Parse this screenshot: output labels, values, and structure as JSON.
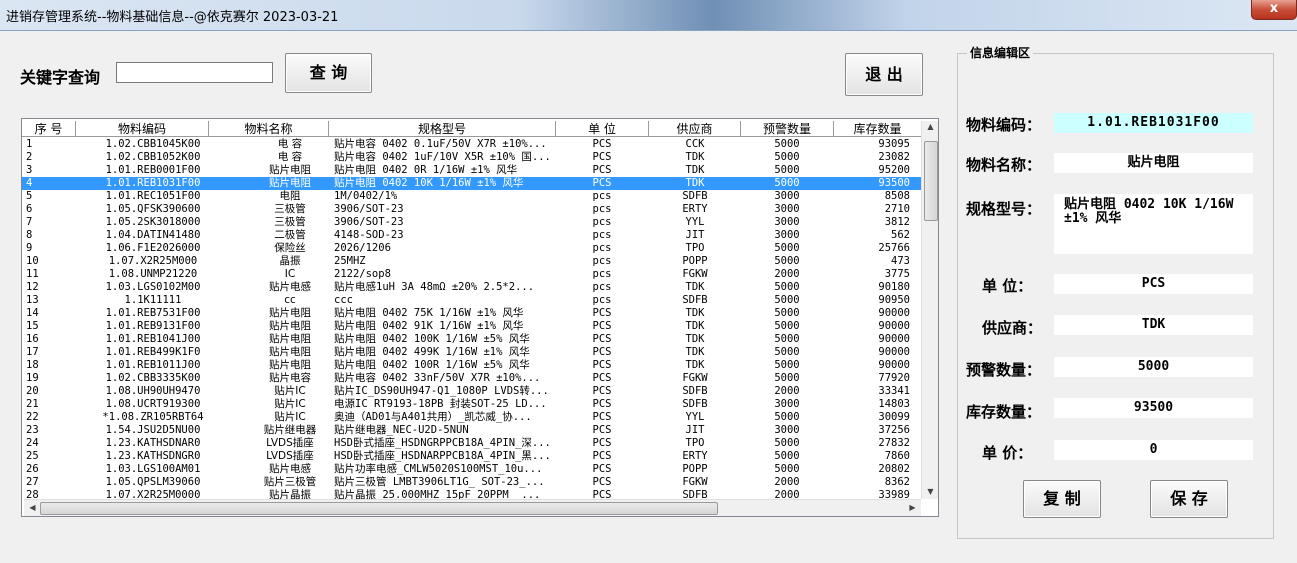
{
  "window": {
    "title": "进销存管理系统--物料基础信息--@依克赛尔 2023-03-21",
    "close_symbol": "x"
  },
  "search": {
    "label": "关键字查询",
    "value": "",
    "query_button": "查 询"
  },
  "exit_button": "退 出",
  "grid": {
    "columns": [
      "序 号",
      "物料编码",
      "物料名称",
      "规格型号",
      "单 位",
      "供应商",
      "预警数量",
      "库存数量"
    ],
    "selected_index": 3,
    "rows": [
      [
        "1",
        "1.02.CBB1045K00",
        "电  容",
        "贴片电容 0402 0.1uF/50V X7R ±10%...",
        "PCS",
        "CCK",
        "5000",
        "93095"
      ],
      [
        "2",
        "1.02.CBB1052K00",
        "电  容",
        "贴片电容 0402 1uF/10V X5R ±10% 国...",
        "PCS",
        "TDK",
        "5000",
        "23082"
      ],
      [
        "3",
        "1.01.REB0001F00",
        "贴片电阻",
        "贴片电阻 0402 0R 1/16W ±1% 风华",
        "PCS",
        "TDK",
        "5000",
        "95200"
      ],
      [
        "4",
        "1.01.REB1031F00",
        "贴片电阻",
        "贴片电阻 0402 10K 1/16W ±1% 风华",
        "PCS",
        "TDK",
        "5000",
        "93500"
      ],
      [
        "5",
        "1.01.REC1051F00",
        "电阻",
        "1M/0402/1%",
        "pcs",
        "SDFB",
        "3000",
        "8508"
      ],
      [
        "6",
        "1.05.QFSK390600",
        "三极管",
        "3906/SOT-23",
        "pcs",
        "ERTY",
        "3000",
        "2710"
      ],
      [
        "7",
        "1.05.2SK3018000",
        "三极管",
        "3906/SOT-23",
        "pcs",
        "YYL",
        "3000",
        "3812"
      ],
      [
        "8",
        "1.04.DATIN41480",
        "二极管",
        "4148-SOD-23",
        "pcs",
        "JIT",
        "3000",
        "562"
      ],
      [
        "9",
        "1.06.F1E2026000",
        "保险丝",
        "2026/1206",
        "pcs",
        "TPO",
        "5000",
        "25766"
      ],
      [
        "10",
        "1.07.X2R25M000",
        "晶振",
        "25MHZ",
        "pcs",
        "POPP",
        "5000",
        "473"
      ],
      [
        "11",
        "1.08.UNMP21220",
        "IC",
        "2122/sop8",
        "pcs",
        "FGKW",
        "2000",
        "3775"
      ],
      [
        "12",
        "1.03.LGS0102M00",
        "贴片电感",
        "贴片电感1uH 3A 48mΩ  ±20% 2.5*2...",
        "pcs",
        "TDK",
        "5000",
        "90180"
      ],
      [
        "13",
        "1.1K11111",
        "cc",
        "ccc",
        "pcs",
        "SDFB",
        "5000",
        "90950"
      ],
      [
        "14",
        "1.01.REB7531F00",
        "贴片电阻",
        "贴片电阻 0402 75K  1/16W  ±1%  风华",
        "PCS",
        "TDK",
        "5000",
        "90000"
      ],
      [
        "15",
        "1.01.REB9131F00",
        "贴片电阻",
        "贴片电阻 0402 91K 1/16W ±1%  风华",
        "PCS",
        "TDK",
        "5000",
        "90000"
      ],
      [
        "16",
        "1.01.REB1041J00",
        "贴片电阻",
        "贴片电阻 0402 100K 1/16W ±5% 风华",
        "PCS",
        "TDK",
        "5000",
        "90000"
      ],
      [
        "17",
        "1.01.REB499K1F0",
        "贴片电阻",
        "贴片电阻 0402 499K 1/16W ±1% 风华",
        "PCS",
        "TDK",
        "5000",
        "90000"
      ],
      [
        "18",
        "1.01.REB1011J00",
        "贴片电阻",
        "贴片电阻 0402 100R 1/16W ±5% 风华",
        "PCS",
        "TDK",
        "5000",
        "90000"
      ],
      [
        "19",
        "1.02.CBB3335K00",
        "贴片电容",
        "贴片电容 0402 33nF/50V X7R ±10%...",
        "PCS",
        "FGKW",
        "5000",
        "77920"
      ],
      [
        "20",
        "1.08.UH90UH9470",
        "贴片IC",
        "贴片IC_DS90UH947-Q1_1080P LVDS转...",
        "PCS",
        "SDFB",
        "2000",
        "33341"
      ],
      [
        "21",
        "1.08.UCRT919300",
        "贴片IC",
        "电源IC RT9193-18PB 封装SOT-25 LD...",
        "PCS",
        "SDFB",
        "3000",
        "14803"
      ],
      [
        "22",
        "*1.08.ZR105RBT64",
        "贴片IC",
        "奥迪（AD01与A401共用）_凯芯威_协...",
        "PCS",
        "YYL",
        "5000",
        "30099"
      ],
      [
        "23",
        "1.54.JSU2D5NU00",
        "贴片继电器",
        "贴片继电器_NEC-U2D-5NUN",
        "PCS",
        "JIT",
        "3000",
        "37256"
      ],
      [
        "24",
        "1.23.KATHSDNAR0",
        "LVDS插座",
        "HSD卧式插座_HSDNGRPPCB18A_4PIN_深...",
        "PCS",
        "TPO",
        "5000",
        "27832"
      ],
      [
        "25",
        "1.23.KATHSDNGR0",
        "LVDS插座",
        "HSD卧式插座_HSDNARPPCB18A_4PIN_黑...",
        "PCS",
        "ERTY",
        "5000",
        "7860"
      ],
      [
        "26",
        "1.03.LGS100AM01",
        "贴片电感",
        "贴片功率电感_CMLW5020S100MST_10u...",
        "PCS",
        "POPP",
        "5000",
        "20802"
      ],
      [
        "27",
        "1.05.QPSLM39060",
        "贴片三极管",
        "贴片三极管 LMBT3906LT1G_ SOT-23_...",
        "PCS",
        "FGKW",
        "2000",
        "8362"
      ],
      [
        "28",
        "1.07.X2R25M0000",
        "贴片晶振",
        "贴片晶振 25.000MHZ 15pF 20PPM _...",
        "PCS",
        "SDFB",
        "2000",
        "33989"
      ]
    ]
  },
  "edit": {
    "legend": "信息编辑区",
    "labels": {
      "code": "物料编码：",
      "name": "物料名称：",
      "spec": "规格型号：",
      "unit": "单   位：",
      "supplier": "供应商：",
      "warn": "预警数量：",
      "stock": "库存数量：",
      "price": "单   价："
    },
    "values": {
      "code": "1.01.REB1031F00",
      "name": "贴片电阻",
      "spec": "贴片电阻 0402 10K 1/16W ±1% 风华",
      "unit": "PCS",
      "supplier": "TDK",
      "warn": "5000",
      "stock": "93500",
      "price": "0"
    },
    "copy_button": "复 制",
    "save_button": "保 存"
  },
  "icons": {
    "scroll_up": "scroll-up-arrow-icon",
    "scroll_down": "scroll-down-arrow-icon",
    "scroll_left": "scroll-left-arrow-icon",
    "scroll_right": "scroll-right-arrow-icon"
  }
}
